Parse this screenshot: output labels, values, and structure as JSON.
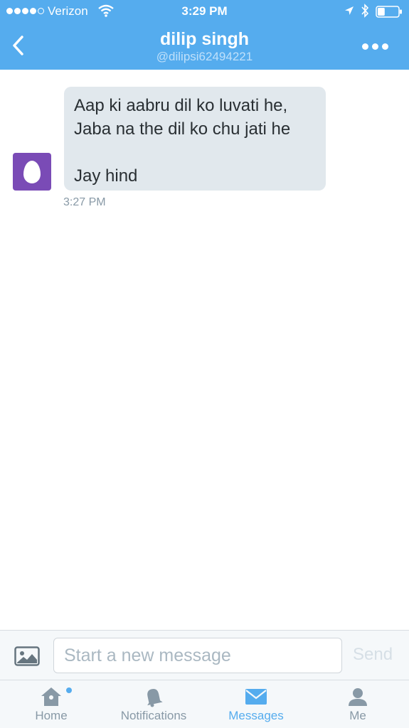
{
  "status_bar": {
    "carrier": "Verizon",
    "time": "3:29 PM",
    "signal_bars_filled": 4,
    "signal_bars_total": 5,
    "battery_level": 0.35
  },
  "header": {
    "title": "dilip singh",
    "handle": "@dilipsi62494221",
    "back_icon": "chevron-left-icon",
    "more_icon": "more-horizontal-icon"
  },
  "conversation": {
    "messages": [
      {
        "text": "Aap ki aabru dil ko luvati he,\nJaba na the dil ko chu jati he\n\nJay hind",
        "time": "3:27 PM",
        "avatar_icon": "egg-avatar-icon"
      }
    ]
  },
  "composer": {
    "placeholder": "Start a new message",
    "value": "",
    "send_label": "Send",
    "photo_icon": "photo-icon"
  },
  "tabbar": {
    "tabs": [
      {
        "label": "Home",
        "icon": "home-icon",
        "active": false,
        "has_badge": true
      },
      {
        "label": "Notifications",
        "icon": "bell-icon",
        "active": false
      },
      {
        "label": "Messages",
        "icon": "envelope-icon",
        "active": true
      },
      {
        "label": "Me",
        "icon": "person-icon",
        "active": false
      }
    ]
  },
  "colors": {
    "brand": "#55acee",
    "bubble": "#e1e8ed",
    "avatar": "#7a4bb6",
    "muted": "#8899a6"
  }
}
